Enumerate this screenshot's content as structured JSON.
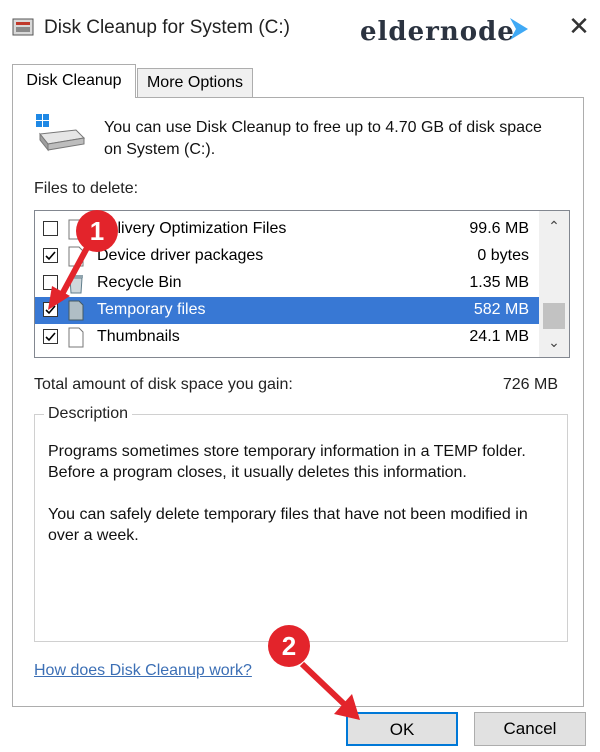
{
  "window": {
    "title": "Disk Cleanup for System (C:)",
    "watermark": "eldernode",
    "close_symbol": "✕"
  },
  "tabs": [
    {
      "label": "Disk Cleanup",
      "active": true
    },
    {
      "label": "More Options",
      "active": false
    }
  ],
  "intro_text": "You can use Disk Cleanup to free up to 4.70 GB of disk space on System (C:).",
  "files_label": "Files to delete:",
  "files": [
    {
      "name": "Delivery Optimization Files",
      "size": "99.6 MB",
      "checked": false,
      "selected": false,
      "icon": "file-icon"
    },
    {
      "name": "Device driver packages",
      "size": "0 bytes",
      "checked": true,
      "selected": false,
      "icon": "file-icon"
    },
    {
      "name": "Recycle Bin",
      "size": "1.35 MB",
      "checked": false,
      "selected": false,
      "icon": "recycle-bin-icon"
    },
    {
      "name": "Temporary files",
      "size": "582 MB",
      "checked": true,
      "selected": true,
      "icon": "file-icon"
    },
    {
      "name": "Thumbnails",
      "size": "24.1 MB",
      "checked": true,
      "selected": false,
      "icon": "file-icon"
    }
  ],
  "total": {
    "label": "Total amount of disk space you gain:",
    "value": "726 MB"
  },
  "description": {
    "legend": "Description",
    "paragraph1": "Programs sometimes store temporary information in a TEMP folder. Before a program closes, it usually deletes this information.",
    "paragraph2": "You can safely delete temporary files that have not been modified in over a week."
  },
  "help_link": "How does Disk Cleanup work?",
  "buttons": {
    "ok": "OK",
    "cancel": "Cancel"
  },
  "annotations": {
    "badge1": "1",
    "badge2": "2"
  },
  "colors": {
    "selection": "#3878d4",
    "badge": "#e3242b",
    "link": "#3c6fb5",
    "ok_border": "#0078d7"
  }
}
